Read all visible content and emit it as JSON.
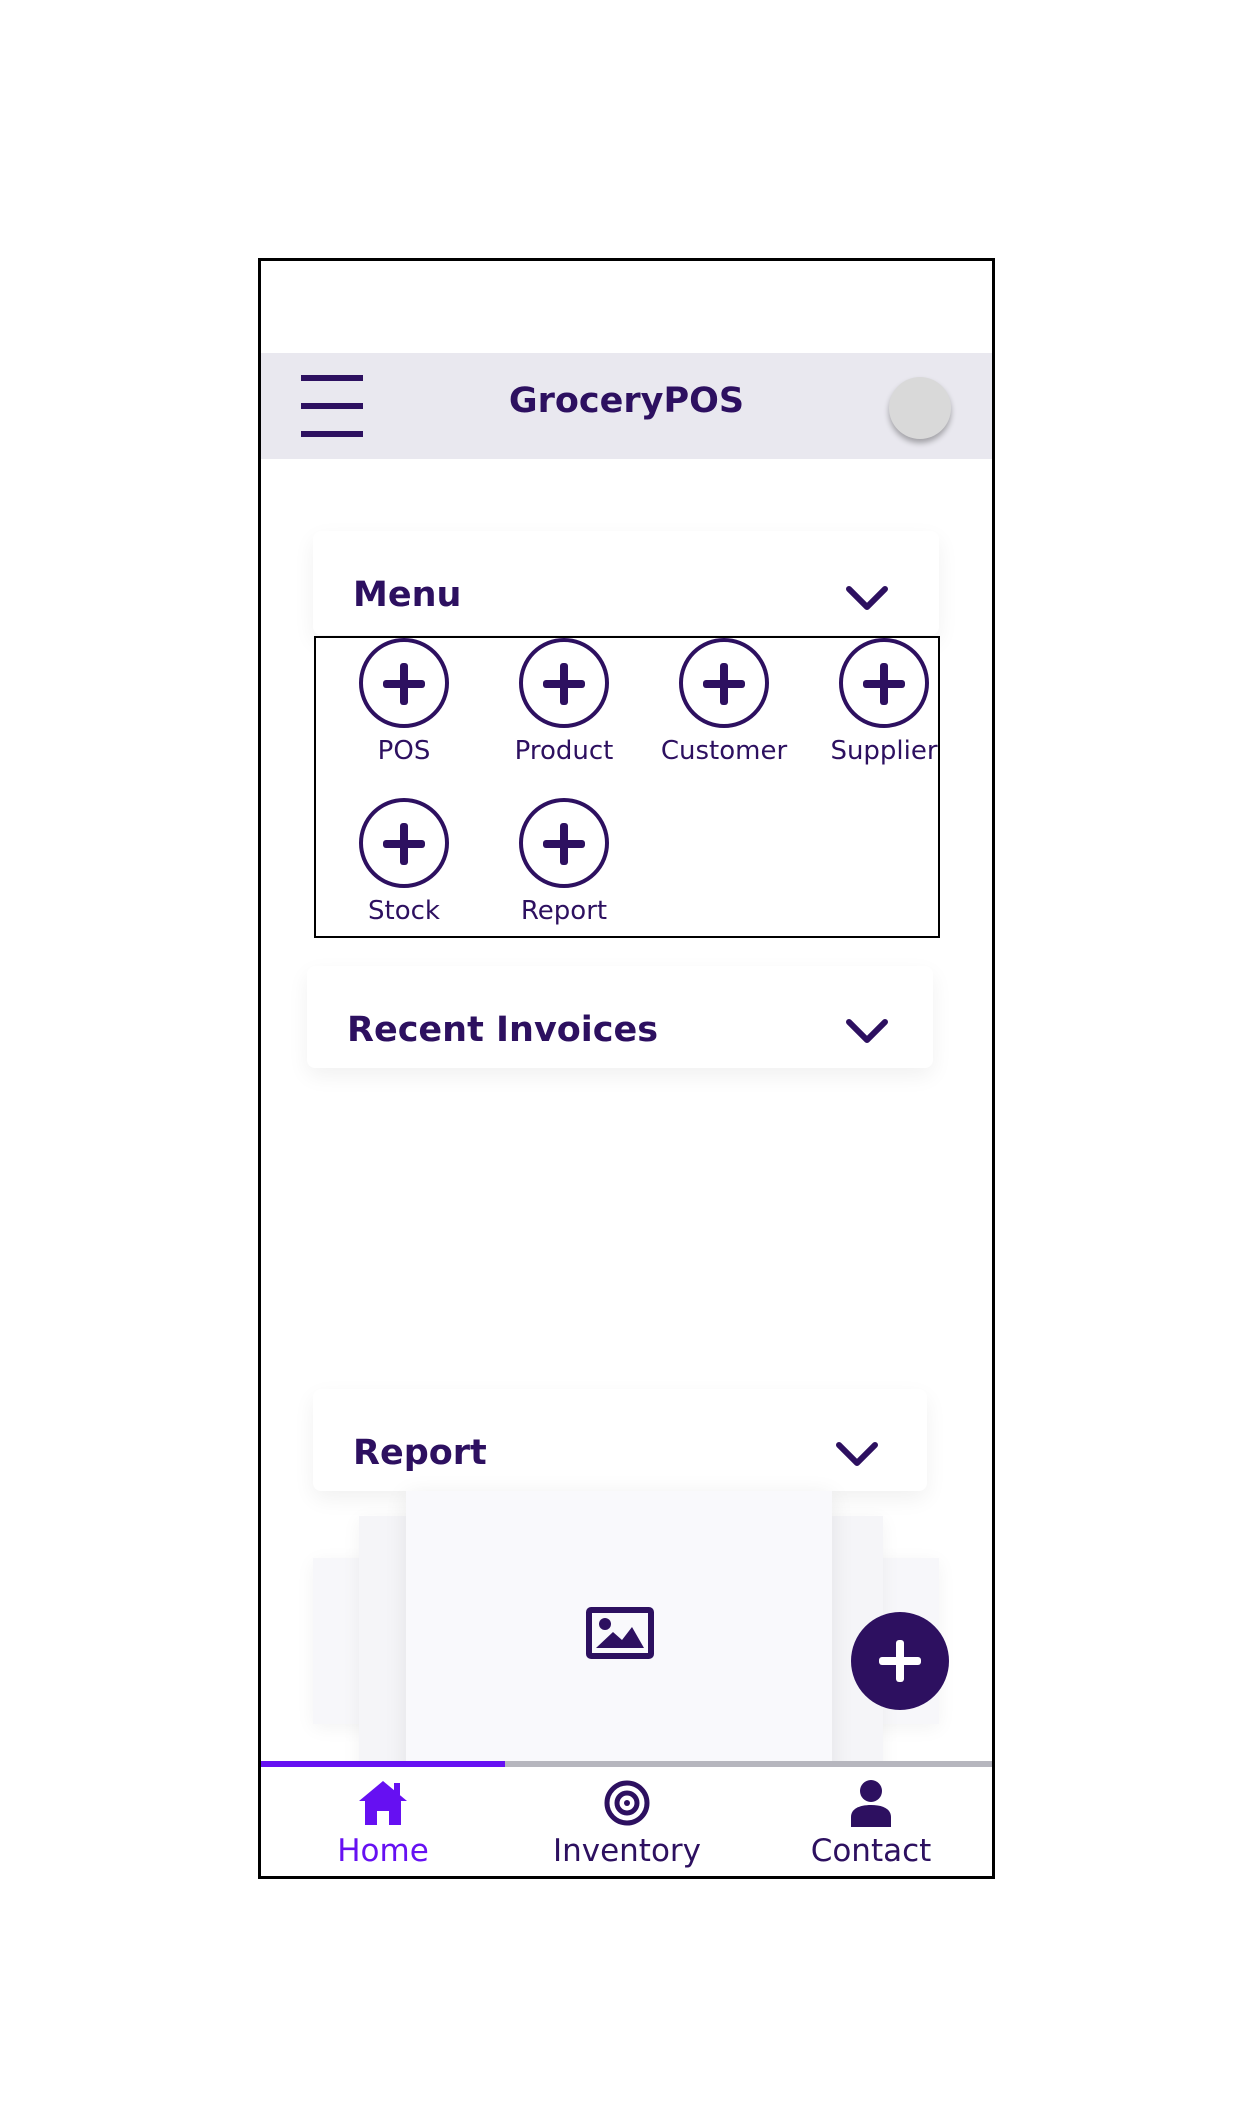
{
  "app_bar": {
    "title": "GroceryPOS",
    "menu_icon": "hamburger-menu-icon",
    "avatar": "avatar"
  },
  "menu_section": {
    "title": "Menu",
    "items": [
      {
        "label": "POS",
        "icon": "add-circle-icon"
      },
      {
        "label": "Product",
        "icon": "add-circle-icon"
      },
      {
        "label": "Customer",
        "icon": "add-circle-icon"
      },
      {
        "label": "Supplier",
        "icon": "add-circle-icon"
      },
      {
        "label": "Stock",
        "icon": "add-circle-icon"
      },
      {
        "label": "Report",
        "icon": "add-circle-icon"
      }
    ]
  },
  "recent_invoices_section": {
    "title": "Recent Invoices"
  },
  "report_section": {
    "title": "Report",
    "carousel_icon": "image-icon"
  },
  "fab": {
    "icon": "plus-icon"
  },
  "bottom_nav": {
    "active_index": 0,
    "tabs": [
      {
        "label": "Home",
        "icon": "home-icon"
      },
      {
        "label": "Inventory",
        "icon": "target-icon"
      },
      {
        "label": "Contact",
        "icon": "person-icon"
      }
    ]
  },
  "colors": {
    "primary": "#2d1060",
    "accent": "#6610f2",
    "app_bar_bg": "#e9e8ef"
  }
}
